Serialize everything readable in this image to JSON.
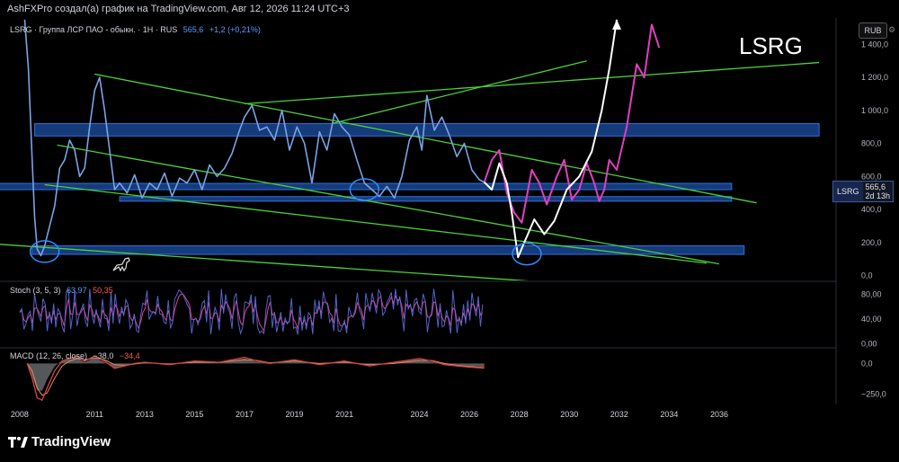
{
  "header": {
    "text": "AshFXPro создал(а) график на TradingView.com, Авг 12, 2026 11:24 UTC+3"
  },
  "main_legend": {
    "title": "LSRG · Группа ЛСР ПАО - обыкн. · 1Н · RUS",
    "price": "565,6",
    "change": "+1,2 (+0,21%)"
  },
  "ticker_label": "LSRG",
  "currency_button": "RUB",
  "price_badge": {
    "symbol": "LSRG",
    "price": "565,6",
    "timer": "2d 13h"
  },
  "stoch_legend": {
    "name": "Stoch (3, 5, 3)",
    "k": "63,97",
    "d": "50,35"
  },
  "macd_legend": {
    "name": "MACD (12, 26, close)",
    "macd": "−38,0",
    "signal": "−34,4"
  },
  "footer": {
    "brand": "TradingView"
  },
  "colors": {
    "price_line": "#7aa3e5",
    "zone_fill": "#1e4fa3",
    "zone_border": "#2f6fe0",
    "channel": "#4cd137",
    "projection_white": "#ffffff",
    "projection_magenta": "#e040c0",
    "stoch_k": "#5b6fe0",
    "stoch_d": "#e0408a",
    "macd_line": "#d64545",
    "macd_hist": "#9aa0a6"
  },
  "chart_data": {
    "type": "line",
    "title": "LSRG",
    "x_ticks": [
      "2008",
      "2011",
      "2013",
      "2015",
      "2017",
      "2019",
      "2021",
      "2024",
      "2026",
      "2028",
      "2030",
      "2032",
      "2034",
      "2036"
    ],
    "x_tick_years": [
      2008.0,
      2011.0,
      2013.0,
      2015.0,
      2017.0,
      2019.0,
      2021.0,
      2024.0,
      2026.0,
      2028.0,
      2030.0,
      2032.0,
      2034.0,
      2036.0
    ],
    "xlim": [
      2007.5,
      2040.5
    ],
    "price_panel": {
      "y_ticks": [
        "0,0",
        "200,0",
        "400,0",
        "600,0",
        "800,0",
        "1 000,0",
        "1 200,0",
        "1 400,0"
      ],
      "y_tick_values": [
        0,
        200,
        400,
        600,
        800,
        1000,
        1200,
        1400
      ],
      "ylim": [
        -30,
        1560
      ],
      "series": [
        {
          "x": [
            2008.2,
            2008.35,
            2008.5,
            2008.6,
            2008.7,
            2008.85,
            2009.0,
            2009.2,
            2009.4,
            2009.6,
            2009.8,
            2010.0,
            2010.2,
            2010.4,
            2010.6,
            2010.8,
            2011.0,
            2011.2,
            2011.4,
            2011.6,
            2011.8,
            2012.0,
            2012.3,
            2012.6,
            2012.9,
            2013.2,
            2013.5,
            2013.8,
            2014.1,
            2014.4,
            2014.7,
            2015.0,
            2015.3,
            2015.6,
            2015.9,
            2016.2,
            2016.5,
            2016.8,
            2017.0,
            2017.3,
            2017.6,
            2017.9,
            2018.2,
            2018.5,
            2018.8,
            2019.1,
            2019.4,
            2019.7,
            2020.0,
            2020.3,
            2020.6,
            2020.9,
            2021.2,
            2021.5,
            2021.8,
            2022.1,
            2022.4,
            2022.7,
            2023.0,
            2023.3,
            2023.6,
            2023.9,
            2024.1,
            2024.3,
            2024.6,
            2024.9,
            2025.2,
            2025.5,
            2025.8,
            2026.1,
            2026.4,
            2026.6
          ],
          "y": [
            1550,
            1250,
            700,
            350,
            160,
            120,
            180,
            300,
            420,
            650,
            700,
            820,
            760,
            600,
            650,
            900,
            1120,
            1200,
            1000,
            760,
            520,
            560,
            500,
            610,
            470,
            560,
            520,
            620,
            480,
            590,
            560,
            640,
            520,
            670,
            600,
            650,
            740,
            880,
            960,
            1030,
            880,
            900,
            820,
            1000,
            760,
            900,
            800,
            560,
            870,
            760,
            980,
            900,
            850,
            700,
            560,
            520,
            480,
            540,
            470,
            600,
            820,
            900,
            760,
            1090,
            880,
            960,
            850,
            720,
            800,
            640,
            580,
            565
          ]
        }
      ],
      "zones": [
        {
          "x": [
            2008.6,
            2040.0
          ],
          "y": [
            845,
            920
          ]
        },
        {
          "x": [
            2006.8,
            2036.5
          ],
          "y": [
            520,
            558
          ]
        },
        {
          "x": [
            2012.0,
            2036.5
          ],
          "y": [
            450,
            478
          ]
        },
        {
          "x": [
            2008.5,
            2037.0
          ],
          "y": [
            128,
            180
          ]
        }
      ],
      "trend_lines": [
        {
          "x": [
            2011.0,
            2037.5
          ],
          "y": [
            1220,
            440
          ]
        },
        {
          "x": [
            2009.5,
            2036.0
          ],
          "y": [
            790,
            70
          ]
        },
        {
          "x": [
            2009.0,
            2035.5
          ],
          "y": [
            550,
            75
          ]
        },
        {
          "x": [
            2005.2,
            2029.0
          ],
          "y": [
            210,
            -40
          ]
        },
        {
          "x": [
            2017.0,
            2040.0
          ],
          "y": [
            1040,
            1290
          ]
        },
        {
          "x": [
            2020.5,
            2030.7
          ],
          "y": [
            920,
            1300
          ]
        }
      ],
      "projection_white": {
        "x": [
          2026.6,
          2026.9,
          2027.2,
          2027.5,
          2027.7,
          2027.95,
          2028.2,
          2028.6,
          2029.0,
          2029.4,
          2029.9,
          2030.4,
          2030.9,
          2031.3,
          2031.6,
          2031.9
        ],
        "y": [
          565,
          520,
          680,
          560,
          380,
          110,
          200,
          340,
          250,
          330,
          520,
          600,
          750,
          1000,
          1250,
          1550
        ]
      },
      "projection_magenta": {
        "x": [
          2026.6,
          2026.9,
          2027.2,
          2027.5,
          2027.8,
          2028.1,
          2028.5,
          2028.8,
          2029.1,
          2029.5,
          2029.8,
          2030.1,
          2030.4,
          2030.7,
          2031.0,
          2031.2,
          2031.4,
          2031.6,
          2031.9,
          2032.3,
          2032.7,
          2033.0,
          2033.3,
          2033.6
        ],
        "y": [
          565,
          700,
          760,
          500,
          380,
          320,
          640,
          560,
          430,
          600,
          700,
          460,
          520,
          680,
          560,
          450,
          520,
          700,
          640,
          900,
          1280,
          1200,
          1520,
          1380
        ]
      },
      "highlight_ellipses": [
        {
          "x": 2009.0,
          "y": 145
        },
        {
          "x": 2021.8,
          "y": 520
        },
        {
          "x": 2028.3,
          "y": 130
        }
      ]
    },
    "stoch_panel": {
      "y_ticks": [
        "0,00",
        "40,00",
        "80,00"
      ],
      "y_tick_values": [
        0,
        40,
        80
      ],
      "ylim": [
        -5,
        100
      ],
      "x_range": [
        2008.0,
        2026.6
      ],
      "k_last": 63.97,
      "d_last": 50.35
    },
    "macd_panel": {
      "y_ticks": [
        "0,0",
        "−250,0"
      ],
      "y_tick_values": [
        0,
        -250
      ],
      "ylim": [
        -320,
        120
      ],
      "x": [
        2008.3,
        2008.5,
        2008.7,
        2008.9,
        2009.1,
        2009.4,
        2009.7,
        2010.0,
        2010.3,
        2010.6,
        2011.0,
        2011.4,
        2011.8,
        2012.2,
        2012.6,
        2013.0,
        2014.0,
        2015.0,
        2016.0,
        2017.0,
        2017.5,
        2018.0,
        2019.0,
        2020.0,
        2021.0,
        2022.0,
        2023.0,
        2024.0,
        2024.5,
        2025.0,
        2025.5,
        2026.0,
        2026.6
      ],
      "macd": [
        0,
        -120,
        -280,
        -300,
        -200,
        -60,
        20,
        40,
        60,
        20,
        60,
        20,
        -40,
        -20,
        0,
        10,
        -10,
        20,
        10,
        50,
        20,
        0,
        30,
        -10,
        20,
        -20,
        10,
        40,
        20,
        -10,
        -20,
        -30,
        -38
      ],
      "signal": [
        0,
        -60,
        -200,
        -260,
        -240,
        -120,
        -20,
        20,
        40,
        30,
        45,
        30,
        -10,
        -15,
        -5,
        5,
        -5,
        10,
        10,
        30,
        25,
        5,
        20,
        0,
        10,
        -10,
        0,
        25,
        25,
        0,
        -15,
        -25,
        -34.4
      ]
    }
  }
}
